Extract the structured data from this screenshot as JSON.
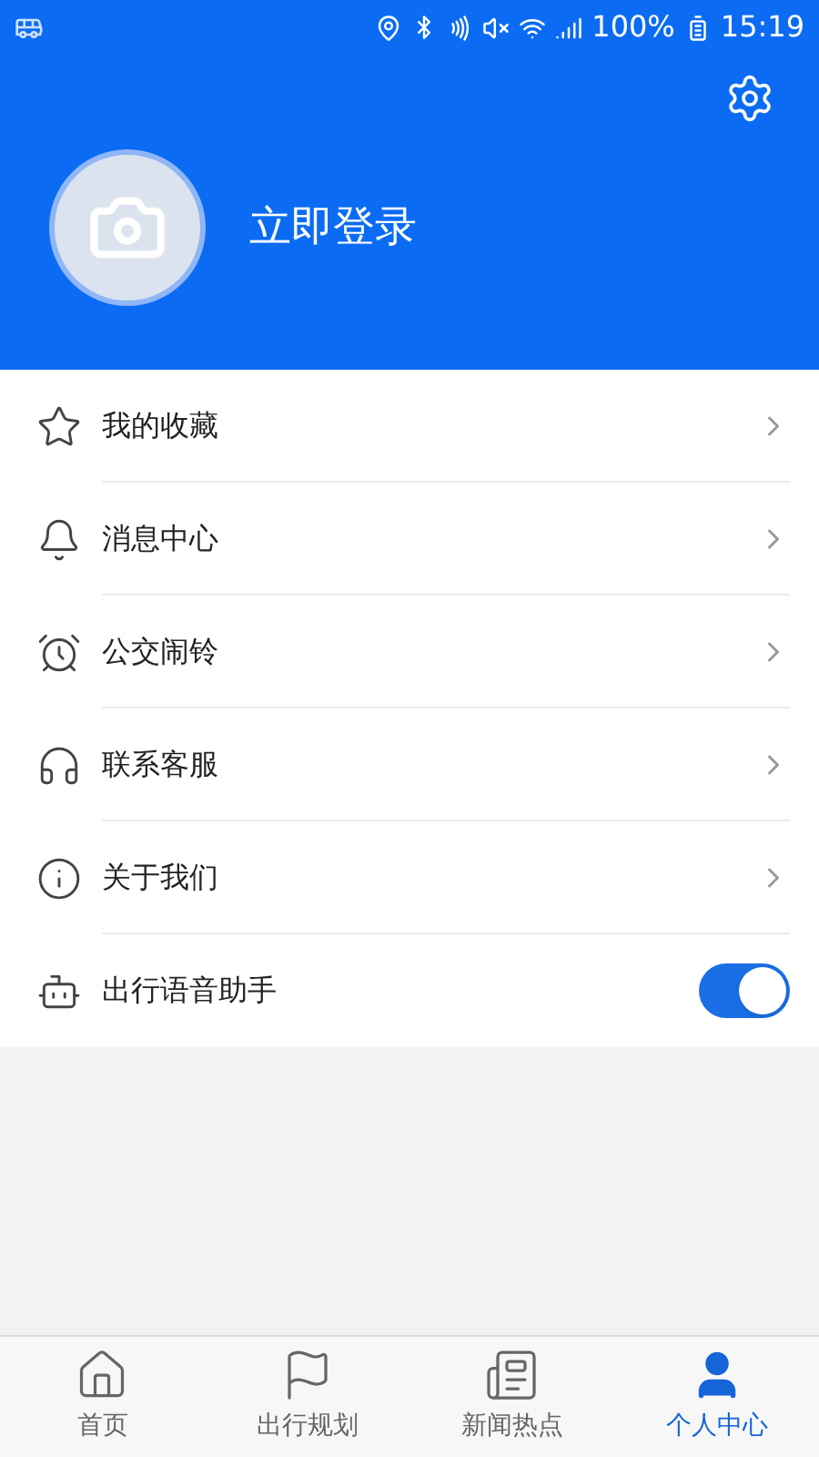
{
  "status_bar": {
    "battery": "100%",
    "time": "15:19"
  },
  "profile": {
    "login_label": "立即登录"
  },
  "menu": [
    {
      "kind": "link",
      "label": "我的收藏"
    },
    {
      "kind": "link",
      "label": "消息中心"
    },
    {
      "kind": "link",
      "label": "公交闹铃"
    },
    {
      "kind": "link",
      "label": "联系客服"
    },
    {
      "kind": "link",
      "label": "关于我们"
    },
    {
      "kind": "toggle",
      "label": "出行语音助手",
      "on": true
    }
  ],
  "tabs": [
    {
      "label": "首页",
      "selected": false
    },
    {
      "label": "出行规划",
      "selected": false
    },
    {
      "label": "新闻热点",
      "selected": false
    },
    {
      "label": "个人中心",
      "selected": true
    }
  ]
}
